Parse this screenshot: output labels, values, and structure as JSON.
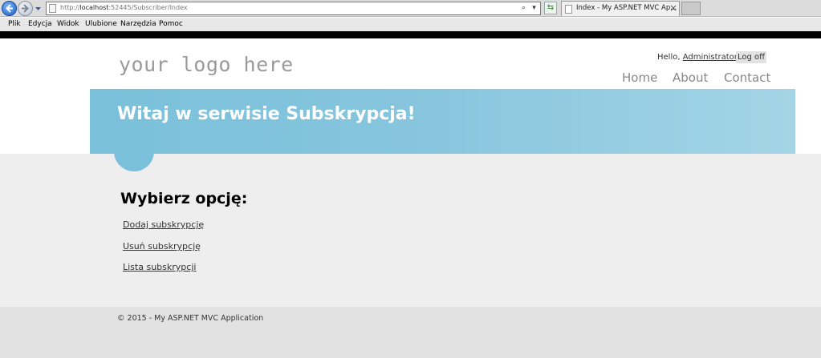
{
  "browser": {
    "url_prefix": "http://",
    "url_host": "localhost",
    "url_rest": ":52445/Subscriber/Index",
    "tab_title": "Index - My ASP.NET MVC Ap...",
    "menu": [
      "Plik",
      "Edycja",
      "Widok",
      "Ulubione",
      "Narzędzia",
      "Pomoc"
    ],
    "icons": {
      "back": "back-arrow-icon",
      "forward": "forward-arrow-icon",
      "tab_close": "close-icon"
    }
  },
  "header": {
    "logo": "your logo here",
    "greeting": "Hello, ",
    "username": "Administrator",
    "greeting_end": "!",
    "logoff": "Log off",
    "nav": [
      "Home",
      "About",
      "Contact"
    ]
  },
  "banner": {
    "title": "Witaj w serwisie Subskrypcja!"
  },
  "main": {
    "heading": "Wybierz opcję:",
    "options": [
      "Dodaj subskrypcję",
      "Usuń subskrypcję",
      "Lista subskrypcji"
    ]
  },
  "footer": {
    "text": "© 2015 - My ASP.NET MVC Application"
  },
  "colors": {
    "accent": "#7ac0da",
    "content_bg": "#efeeef",
    "footer_bg": "#e2e2e2"
  }
}
